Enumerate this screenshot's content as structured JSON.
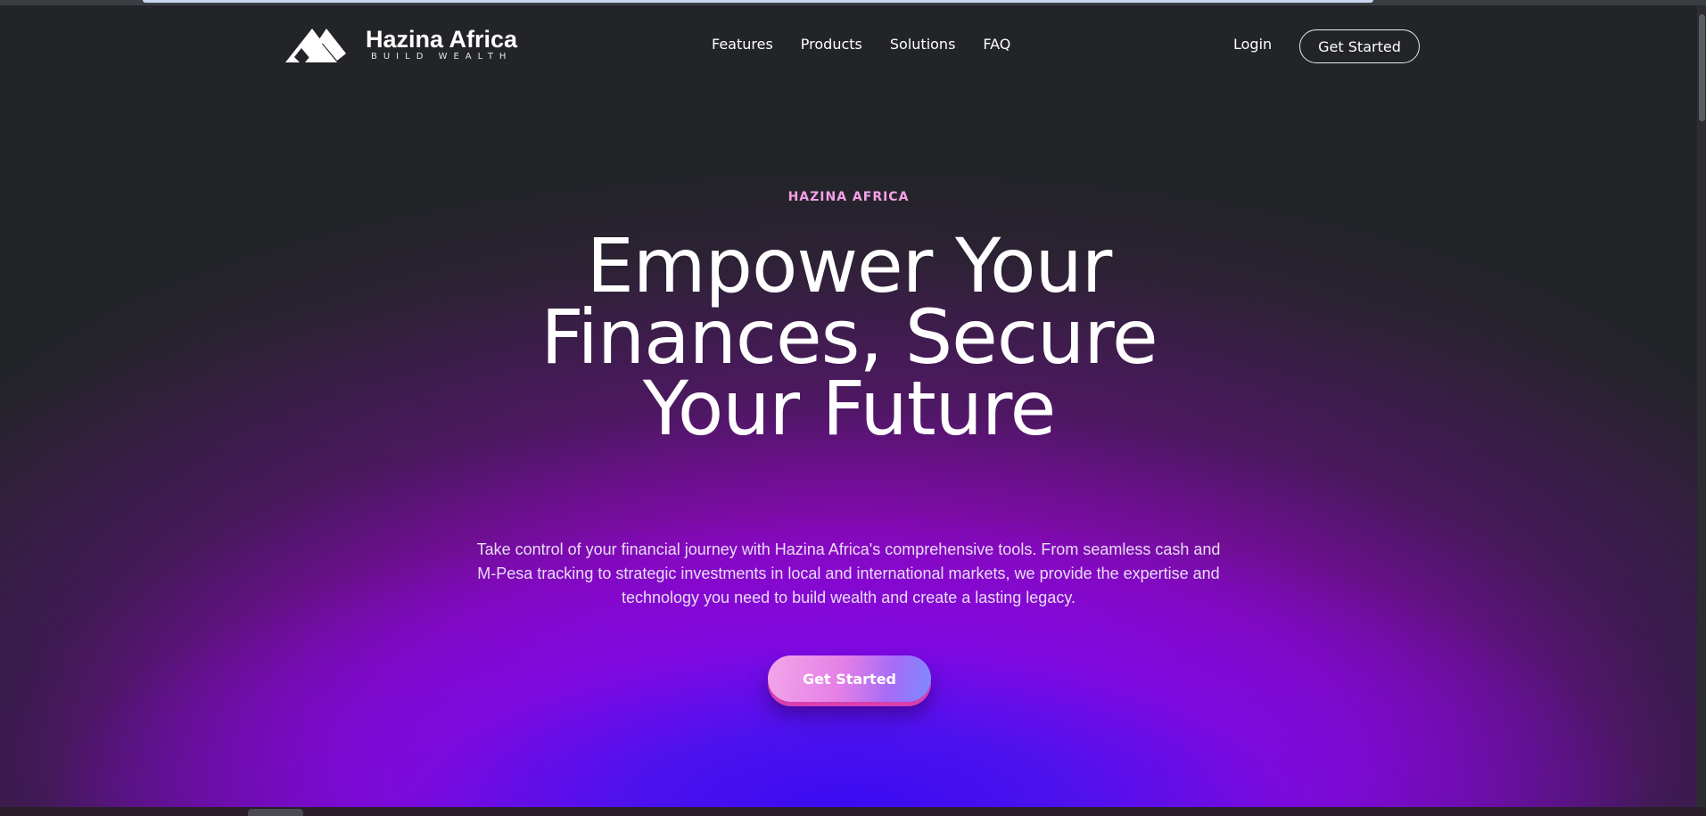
{
  "brand": {
    "name": "Hazina Africa",
    "tagline": "BUILD WEALTH"
  },
  "nav": {
    "items": [
      {
        "label": "Features"
      },
      {
        "label": "Products"
      },
      {
        "label": "Solutions"
      },
      {
        "label": "FAQ"
      }
    ],
    "login_label": "Login",
    "cta_label": "Get Started"
  },
  "hero": {
    "eyebrow": "HAZINA AFRICA",
    "headline": "Empower Your Finances, Secure Your Future",
    "description": "Take control of your financial journey with Hazina Africa's comprehensive tools. From seamless cash and M-Pesa tracking to strategic investments in local and international markets, we provide the expertise and technology you need to build wealth and create a lasting legacy.",
    "cta_label": "Get Started"
  },
  "colors": {
    "background": "#222428",
    "eyebrow": "#f4a2e6",
    "glow_purple": "#a000e6",
    "glow_blue": "#3a0bf2"
  }
}
